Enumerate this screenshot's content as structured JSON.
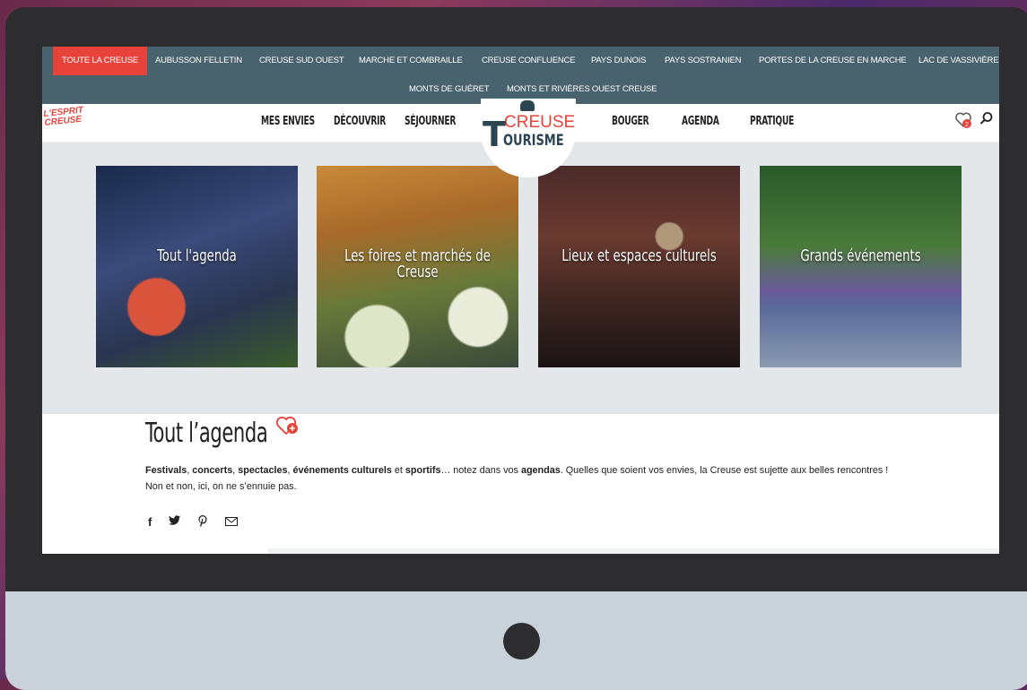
{
  "regions": {
    "row1": [
      {
        "label": "TOUTE LA CREUSE",
        "active": true
      },
      {
        "label": "AUBUSSON FELLETIN"
      },
      {
        "label": "CREUSE SUD OUEST"
      },
      {
        "label": "MARCHE ET COMBRAILLE"
      },
      {
        "label": "CREUSE CONFLUENCE"
      },
      {
        "label": "PAYS DUNOIS"
      },
      {
        "label": "PAYS SOSTRANIEN"
      },
      {
        "label": "PORTES DE LA CREUSE EN MARCHE"
      },
      {
        "label": "LAC DE VASSIVIÈRE"
      }
    ],
    "row2": [
      {
        "label": "MONTS DE GUÉRET"
      },
      {
        "label": "MONTS ET RIVIÈRES OUEST CREUSE"
      }
    ]
  },
  "nav": {
    "esprit_logo": "L'ESPRIT CREUSE",
    "items": [
      "MES ENVIES",
      "DÉCOUVRIR",
      "SÉJOURNER",
      "BOUGER",
      "AGENDA",
      "PRATIQUE"
    ],
    "logo_top": "CREUSE",
    "logo_t": "T",
    "logo_bottom": "OURISME",
    "favorites_count": "2"
  },
  "cards": [
    {
      "label": "Tout l'agenda"
    },
    {
      "label": "Les foires et marchés de Creuse"
    },
    {
      "label": "Lieux et espaces culturels"
    },
    {
      "label": "Grands événements"
    }
  ],
  "content": {
    "title": "Tout l’agenda",
    "line2": "Non et non, ici, on ne s’ennuie pas."
  },
  "colors": {
    "accent": "#e8433b",
    "region_bar": "#49636e",
    "brand_dark": "#2c4553"
  }
}
